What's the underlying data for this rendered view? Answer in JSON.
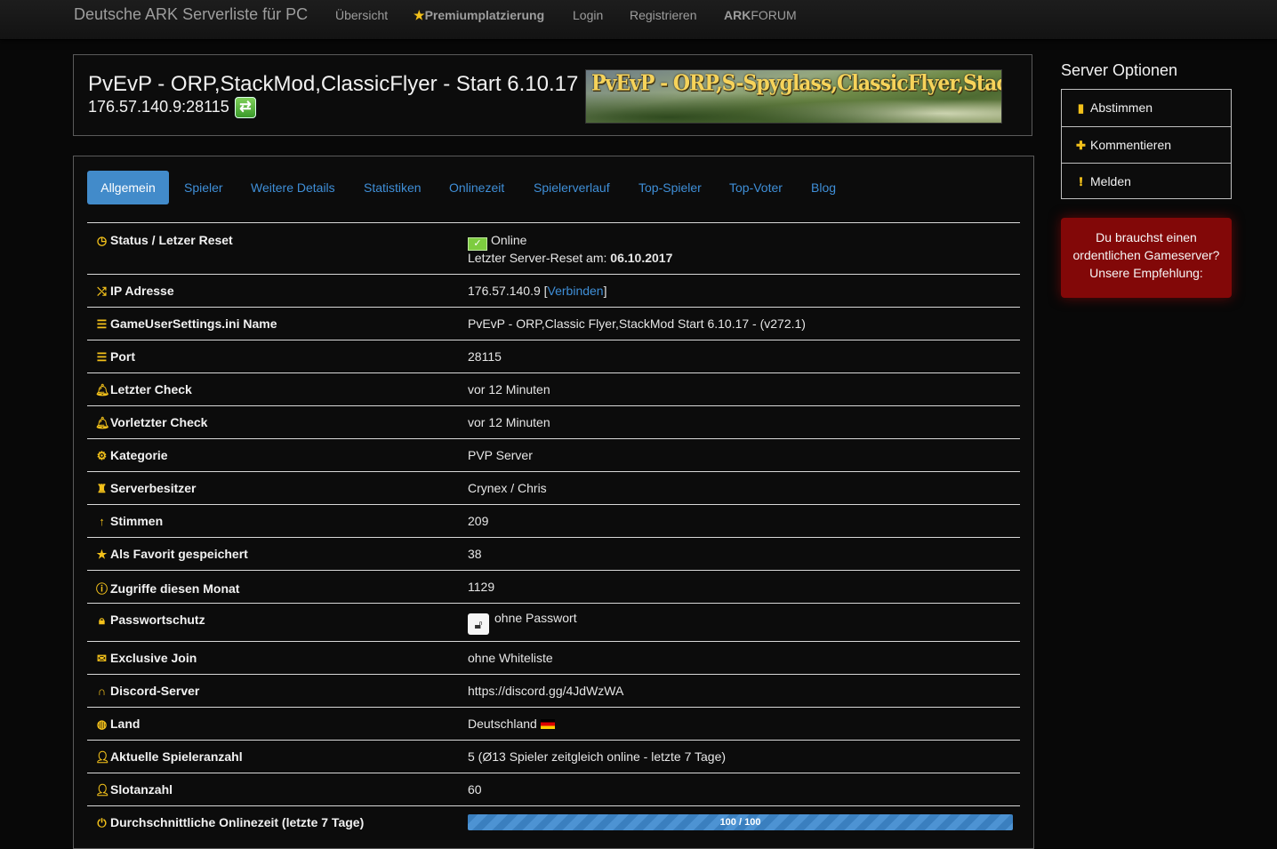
{
  "nav": {
    "brand": "Deutsche ARK Serverliste für PC",
    "overview": "Übersicht",
    "premium_star": "★",
    "premium": "Premiumplatzierung",
    "login": "Login",
    "register": "Registrieren",
    "forum_bold": "ARK",
    "forum_rest": "FORUM"
  },
  "server": {
    "title": "PvEvP - ORP,StackMod,ClassicFlyer - Start 6.10.17",
    "address": "176.57.140.9:28115",
    "banner_text": "PvEvP - ORP,S-Spyglass,ClassicFlyer,Stackmod"
  },
  "tabs": [
    "Allgemein",
    "Spieler",
    "Weitere Details",
    "Statistiken",
    "Onlinezeit",
    "Spielerverlauf",
    "Top-Spieler",
    "Top-Voter",
    "Blog"
  ],
  "details": {
    "status_label": "Status / Letzer Reset",
    "status_value": "Online",
    "reset_prefix": "Letzter Server-Reset am:",
    "reset_date": "06.10.2017",
    "ip_label": "IP Adresse",
    "ip_value": "176.57.140.9",
    "ip_open": "[",
    "ip_connect": "Verbinden",
    "ip_close": "]",
    "gus_label": "GameUserSettings.ini Name",
    "gus_value": "PvEvP - ORP,Classic Flyer,StackMod Start 6.10.17 - (v272.1)",
    "port_label": "Port",
    "port_value": "28115",
    "lastcheck_label": "Letzter Check",
    "lastcheck_value": "vor 12 Minuten",
    "prevcheck_label": "Vorletzter Check",
    "prevcheck_value": "vor 12 Minuten",
    "category_label": "Kategorie",
    "category_value": "PVP Server",
    "owner_label": "Serverbesitzer",
    "owner_value": "Crynex / Chris",
    "votes_label": "Stimmen",
    "votes_value": "209",
    "fav_label": "Als Favorit gespeichert",
    "fav_value": "38",
    "hits_label": "Zugriffe diesen Monat",
    "hits_value": "1129",
    "pw_label": "Passwortschutz",
    "pw_value": "ohne Passwort",
    "exclusive_label": "Exclusive Join",
    "exclusive_value": "ohne Whiteliste",
    "discord_label": "Discord-Server",
    "discord_value": "https://discord.gg/4JdWzWA",
    "country_label": "Land",
    "country_value": "Deutschland",
    "players_label": "Aktuelle Spieleranzahl",
    "players_value": "5 (Ø13 Spieler zeitgleich online - letzte 7 Tage)",
    "slots_label": "Slotanzahl",
    "slots_value": "60",
    "uptime_label": "Durchschnittliche Onlinezeit (letzte 7 Tage)",
    "uptime_text": "100 / 100",
    "uptime_fraction": 1.0
  },
  "sidebar": {
    "heading": "Server Optionen",
    "vote": "Abstimmen",
    "comment": "Kommentieren",
    "report": "Melden",
    "promo": [
      "Du brauchst einen",
      "ordentlichen Gameserver?",
      "Unsere Empfehlung:"
    ]
  },
  "colors": {
    "accent": "#428bca",
    "link": "#3f8fd8",
    "icon": "#f3c11a",
    "online": "#7dcc3f",
    "promo": "#820808"
  }
}
